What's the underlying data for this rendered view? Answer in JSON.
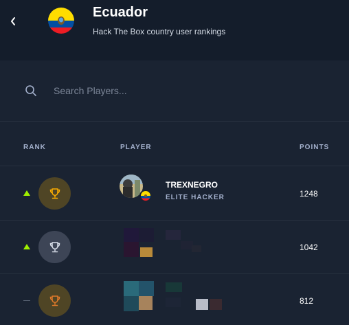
{
  "header": {
    "title": "Ecuador",
    "subtitle": "Hack The Box country user rankings"
  },
  "search": {
    "placeholder": "Search Players..."
  },
  "table": {
    "columns": [
      "RANK",
      "PLAYER",
      "POINTS"
    ],
    "rows": [
      {
        "trend": "up",
        "trophy": "gold",
        "player_name": "TREXNEGRO",
        "player_rank": "ELITE HACKER",
        "points": "1248"
      },
      {
        "trend": "up",
        "trophy": "silver",
        "player_name": "",
        "player_rank": "",
        "points": "1042"
      },
      {
        "trend": "neutral",
        "trophy": "bronze",
        "player_name": "",
        "player_rank": "",
        "points": "812"
      }
    ]
  },
  "colors": {
    "background": "#1a2332",
    "header_background": "#141d2b",
    "trend_up": "#9fef00",
    "trophy_gold": "#ffaf00",
    "trophy_silver": "#a4b1cd"
  },
  "icons": {
    "back": "chevron-left-icon",
    "flag": "ecuador-flag-icon",
    "search": "search-icon",
    "trophy": "trophy-icon",
    "trend_up": "caret-up-icon"
  }
}
